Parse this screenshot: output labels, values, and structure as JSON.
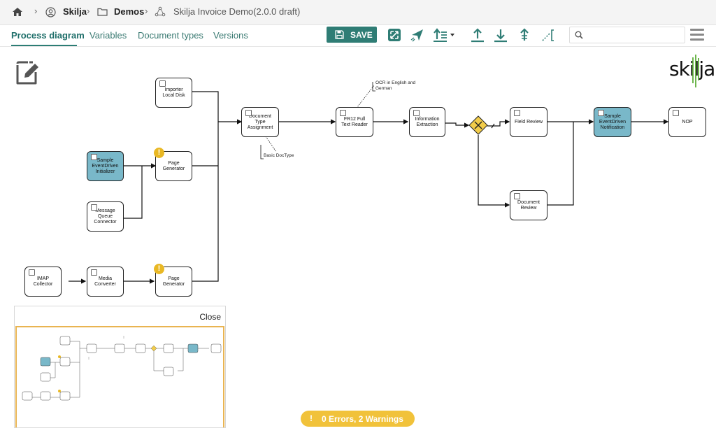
{
  "breadcrumb": {
    "items": [
      "Skilja",
      "Demos",
      "Skilja Invoice Demo(2.0.0 draft)"
    ]
  },
  "tabs": [
    {
      "label": "Process diagram",
      "active": true
    },
    {
      "label": "Variables",
      "active": false
    },
    {
      "label": "Document types",
      "active": false
    },
    {
      "label": "Versions",
      "active": false
    }
  ],
  "toolbar": {
    "save_label": "SAVE",
    "search_placeholder": ""
  },
  "logo": {
    "text": "skilja"
  },
  "nodes": {
    "importer": "Importer Local Disk",
    "sample_init": "Sample EventDriven Initializer",
    "page_gen_1": "Page Generator",
    "mq_connector": "Message Queue Connector",
    "imap": "IMAP Collector",
    "media_conv": "Media Converter",
    "page_gen_2": "Page Generator",
    "doc_type": "Document Type Assignment",
    "fr12": "FR12 Full Text Reader",
    "info_extract": "Information Extraction",
    "field_review": "Field Review",
    "doc_review": "Document Review",
    "sample_notify": "Sample EventDriven Notification",
    "nop": "NOP"
  },
  "annotations": {
    "ocr": "OCR in English and German",
    "basic": "Basic DocType"
  },
  "minimap": {
    "close_label": "Close"
  },
  "status": {
    "text": "0 Errors, 2 Warnings"
  },
  "colors": {
    "accent": "#2f7d75",
    "highlight_node": "#79b8c9",
    "warning": "#e9b824"
  }
}
